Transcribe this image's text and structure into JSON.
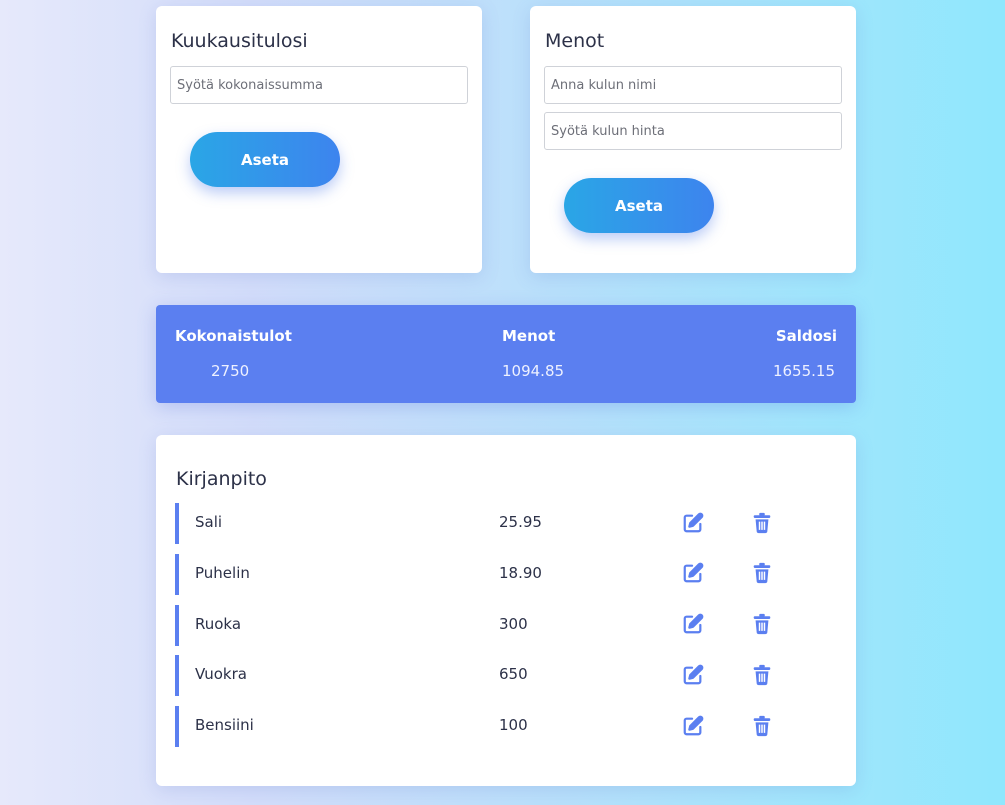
{
  "income": {
    "title": "Kuukausitulosi",
    "total_placeholder": "Syötä kokonaissumma",
    "total_value": "",
    "button_label": "Aseta"
  },
  "expenses_form": {
    "title": "Menot",
    "name_placeholder": "Anna kulun nimi",
    "name_value": "",
    "price_placeholder": "Syötä kulun hinta",
    "price_value": "",
    "button_label": "Aseta"
  },
  "summary": {
    "income_label": "Kokonaistulot",
    "income_value": "2750",
    "expenses_label": "Menot",
    "expenses_value": "1094.85",
    "balance_label": "Saldosi",
    "balance_value": "1655.15"
  },
  "ledger": {
    "title": "Kirjanpito",
    "items": [
      {
        "name": "Sali",
        "amount": "25.95"
      },
      {
        "name": "Puhelin",
        "amount": "18.90"
      },
      {
        "name": "Ruoka",
        "amount": "300"
      },
      {
        "name": "Vuokra",
        "amount": "650"
      },
      {
        "name": "Bensiini",
        "amount": "100"
      }
    ]
  },
  "icons": {
    "edit": "edit-icon",
    "delete": "trash-icon"
  },
  "colors": {
    "accent": "#5b7ff0",
    "button_gradient_start": "#2aa6e6",
    "button_gradient_end": "#3d84ee",
    "text": "#2c3148"
  }
}
